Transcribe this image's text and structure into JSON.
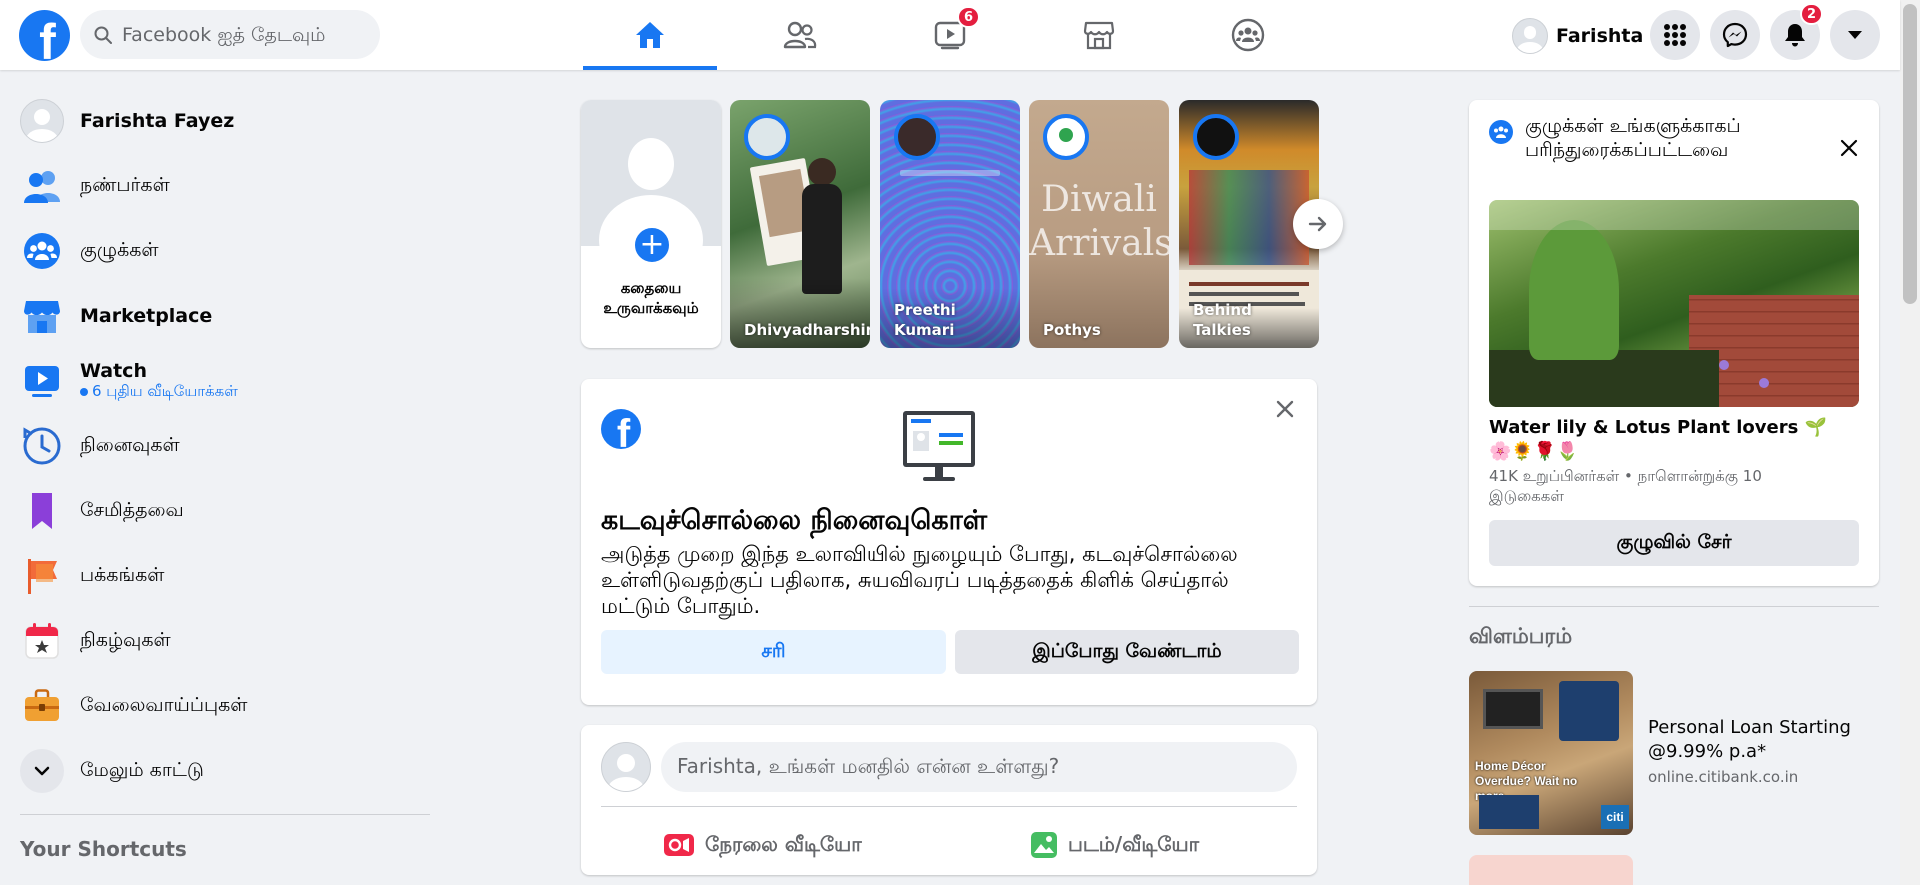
{
  "topbar": {
    "logo_letter": "f",
    "search_placeholder": "Facebook ஐத் தேடவும்",
    "watch_badge": "6",
    "profile_name": "Farishta",
    "notifications_badge": "2",
    "accent": "#1877f2"
  },
  "sidebar": {
    "profile": "Farishta Fayez",
    "friends": "நண்பர்கள்",
    "groups": "குழுக்கள்",
    "marketplace": "Marketplace",
    "watch": "Watch",
    "watch_sub": "6 புதிய வீடியோக்கள்",
    "memories": "நினைவுகள்",
    "saved": "சேமித்தவை",
    "pages": "பக்கங்கள்",
    "events": "நிகழ்வுகள்",
    "jobs": "வேலைவாய்ப்புகள்",
    "see_more": "மேலும் காட்டு",
    "shortcuts_title": "Your Shortcuts"
  },
  "stories": {
    "create_label": "கதையை உருவாக்கவும்",
    "items": [
      {
        "name": "Dhivyadharshini"
      },
      {
        "name": "Preethi Kumari"
      },
      {
        "name": "Pothys"
      },
      {
        "name": "Behind Talkies"
      }
    ],
    "pothys_image_text": "Diwali Arrivals"
  },
  "password_card": {
    "title": "கடவுச்சொல்லை நினைவுகொள்",
    "body": "அடுத்த முறை இந்த உலாவியில் நுழையும் போது, கடவுச்சொல்லை உள்ளிடுவதற்குப் பதிலாக, சுயவிவரப் படித்ததைக் கிளிக் செய்தால் மட்டும் போதும்.",
    "ok_label": "சரி",
    "not_now_label": "இப்போது வேண்டாம்"
  },
  "composer": {
    "placeholder": "Farishta, உங்கள் மனதில் என்ன உள்ளது?",
    "live_label": "நேரலை வீடியோ",
    "photo_label": "படம்/வீடியோ"
  },
  "groups_suggestion": {
    "header": "குழுக்கள் உங்களுக்காகப் பரிந்துரைக்கப்பட்டவை",
    "name": "Water lily & Lotus Plant lovers 🌱🌸🌻🌹🌷",
    "meta": "41K உறுப்பினர்கள் • நாளொன்றுக்கு 10 இடுகைகள்",
    "join_label": "குழுவில் சேர்"
  },
  "ads": {
    "title": "விளம்பரம்",
    "item": {
      "headline": "Personal Loan Starting @9.99% p.a*",
      "url": "online.citibank.co.in",
      "image_text": "Home Décor Overdue? Wait no more.",
      "image_logo": "citi"
    }
  }
}
